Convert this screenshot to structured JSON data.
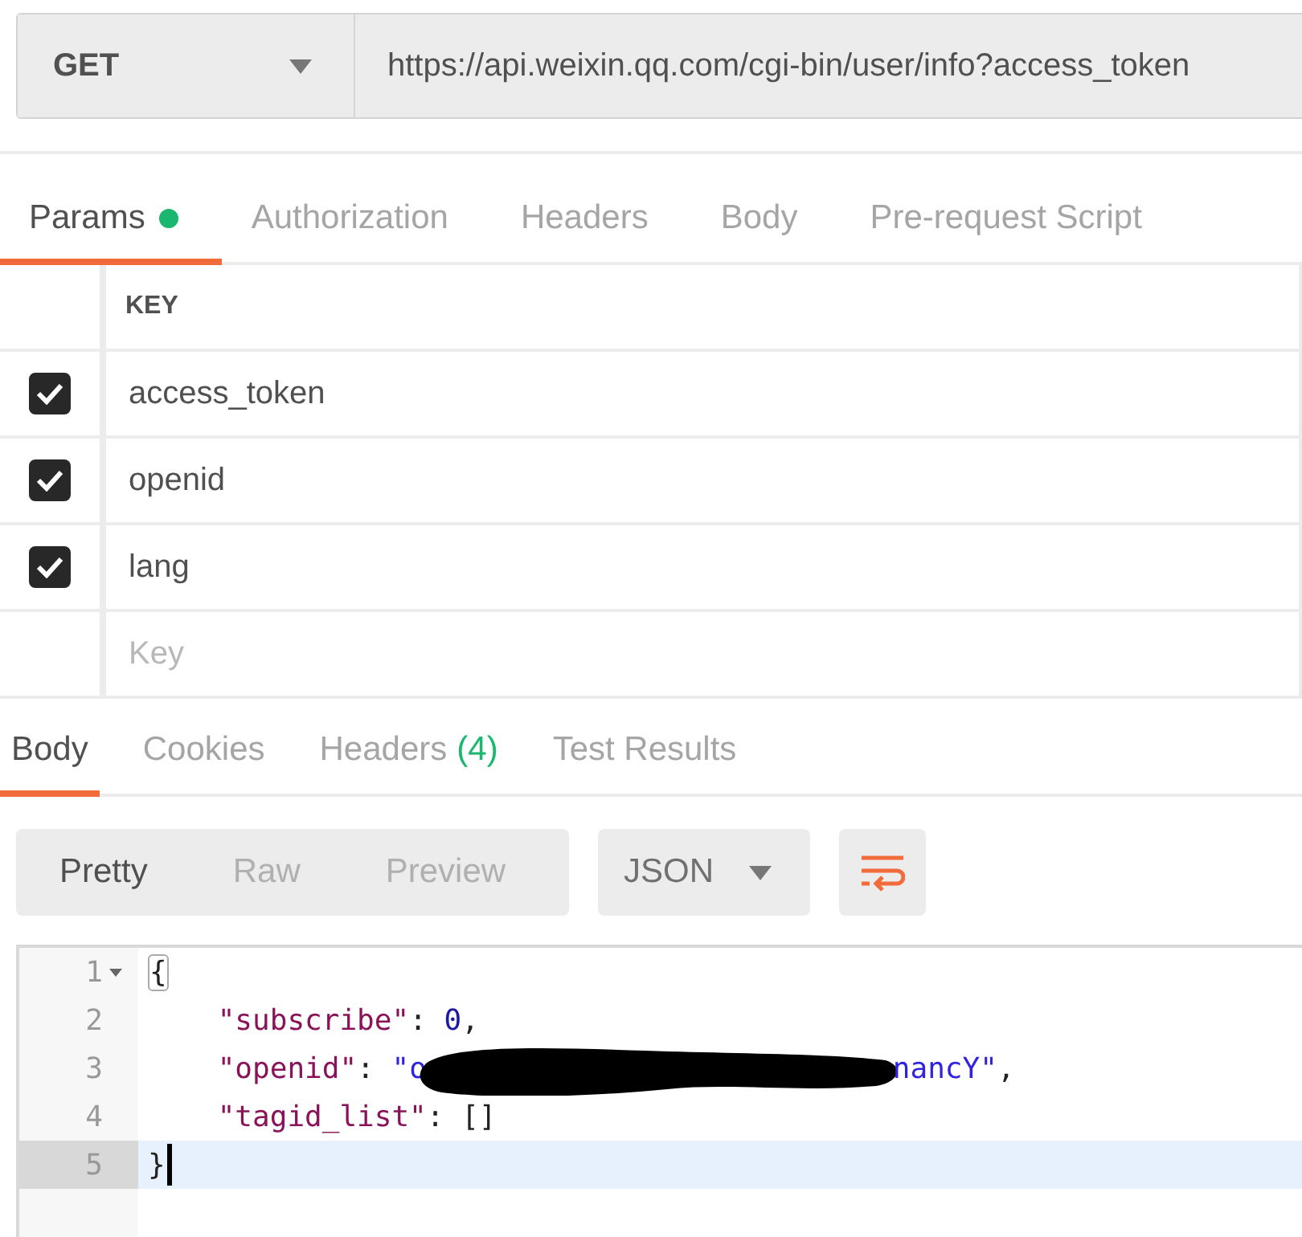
{
  "request": {
    "method": "GET",
    "url": "https://api.weixin.qq.com/cgi-bin/user/info?access_token"
  },
  "request_tabs": [
    {
      "label": "Params",
      "selected": true,
      "indicator": true
    },
    {
      "label": "Authorization",
      "selected": false,
      "indicator": false
    },
    {
      "label": "Headers",
      "selected": false,
      "indicator": false
    },
    {
      "label": "Body",
      "selected": false,
      "indicator": false
    },
    {
      "label": "Pre-request Script",
      "selected": false,
      "indicator": false
    }
  ],
  "params": {
    "column": "KEY",
    "placeholder": "Key",
    "rows": [
      {
        "key": "access_token",
        "checked": true
      },
      {
        "key": "openid",
        "checked": true
      },
      {
        "key": "lang",
        "checked": true
      }
    ]
  },
  "response_tabs": [
    {
      "label": "Body",
      "selected": true
    },
    {
      "label": "Cookies",
      "selected": false
    },
    {
      "label": "Headers",
      "count": "(4)",
      "selected": false
    },
    {
      "label": "Test Results",
      "selected": false
    }
  ],
  "view_modes": [
    {
      "label": "Pretty",
      "selected": true
    },
    {
      "label": "Raw",
      "selected": false
    },
    {
      "label": "Preview",
      "selected": false
    }
  ],
  "format": "JSON",
  "code": [
    {
      "number": "1",
      "foldable": true,
      "active": false,
      "tokens": [
        {
          "kind": "bracket",
          "text": "{",
          "matched": true
        }
      ]
    },
    {
      "number": "2",
      "foldable": false,
      "active": false,
      "tokens": [
        {
          "kind": "key",
          "text": "    \"subscribe\""
        },
        {
          "kind": "punct",
          "text": ": "
        },
        {
          "kind": "number",
          "text": "0"
        },
        {
          "kind": "punct",
          "text": ","
        }
      ]
    },
    {
      "number": "3",
      "foldable": false,
      "active": false,
      "tokens": [
        {
          "kind": "key",
          "text": "    \"openid\""
        },
        {
          "kind": "punct",
          "text": ": "
        },
        {
          "kind": "string",
          "text": "\"o"
        },
        {
          "kind": "redaction"
        },
        {
          "kind": "string",
          "text": "nancY\""
        },
        {
          "kind": "punct",
          "text": ","
        }
      ]
    },
    {
      "number": "4",
      "foldable": false,
      "active": false,
      "tokens": [
        {
          "kind": "key",
          "text": "    \"tagid_list\""
        },
        {
          "kind": "punct",
          "text": ": "
        },
        {
          "kind": "bracket",
          "text": "[]",
          "matched": false
        }
      ]
    },
    {
      "number": "5",
      "foldable": false,
      "active": true,
      "cursor": true,
      "tokens": [
        {
          "kind": "bracket",
          "text": "}",
          "matched": false
        }
      ]
    }
  ]
}
